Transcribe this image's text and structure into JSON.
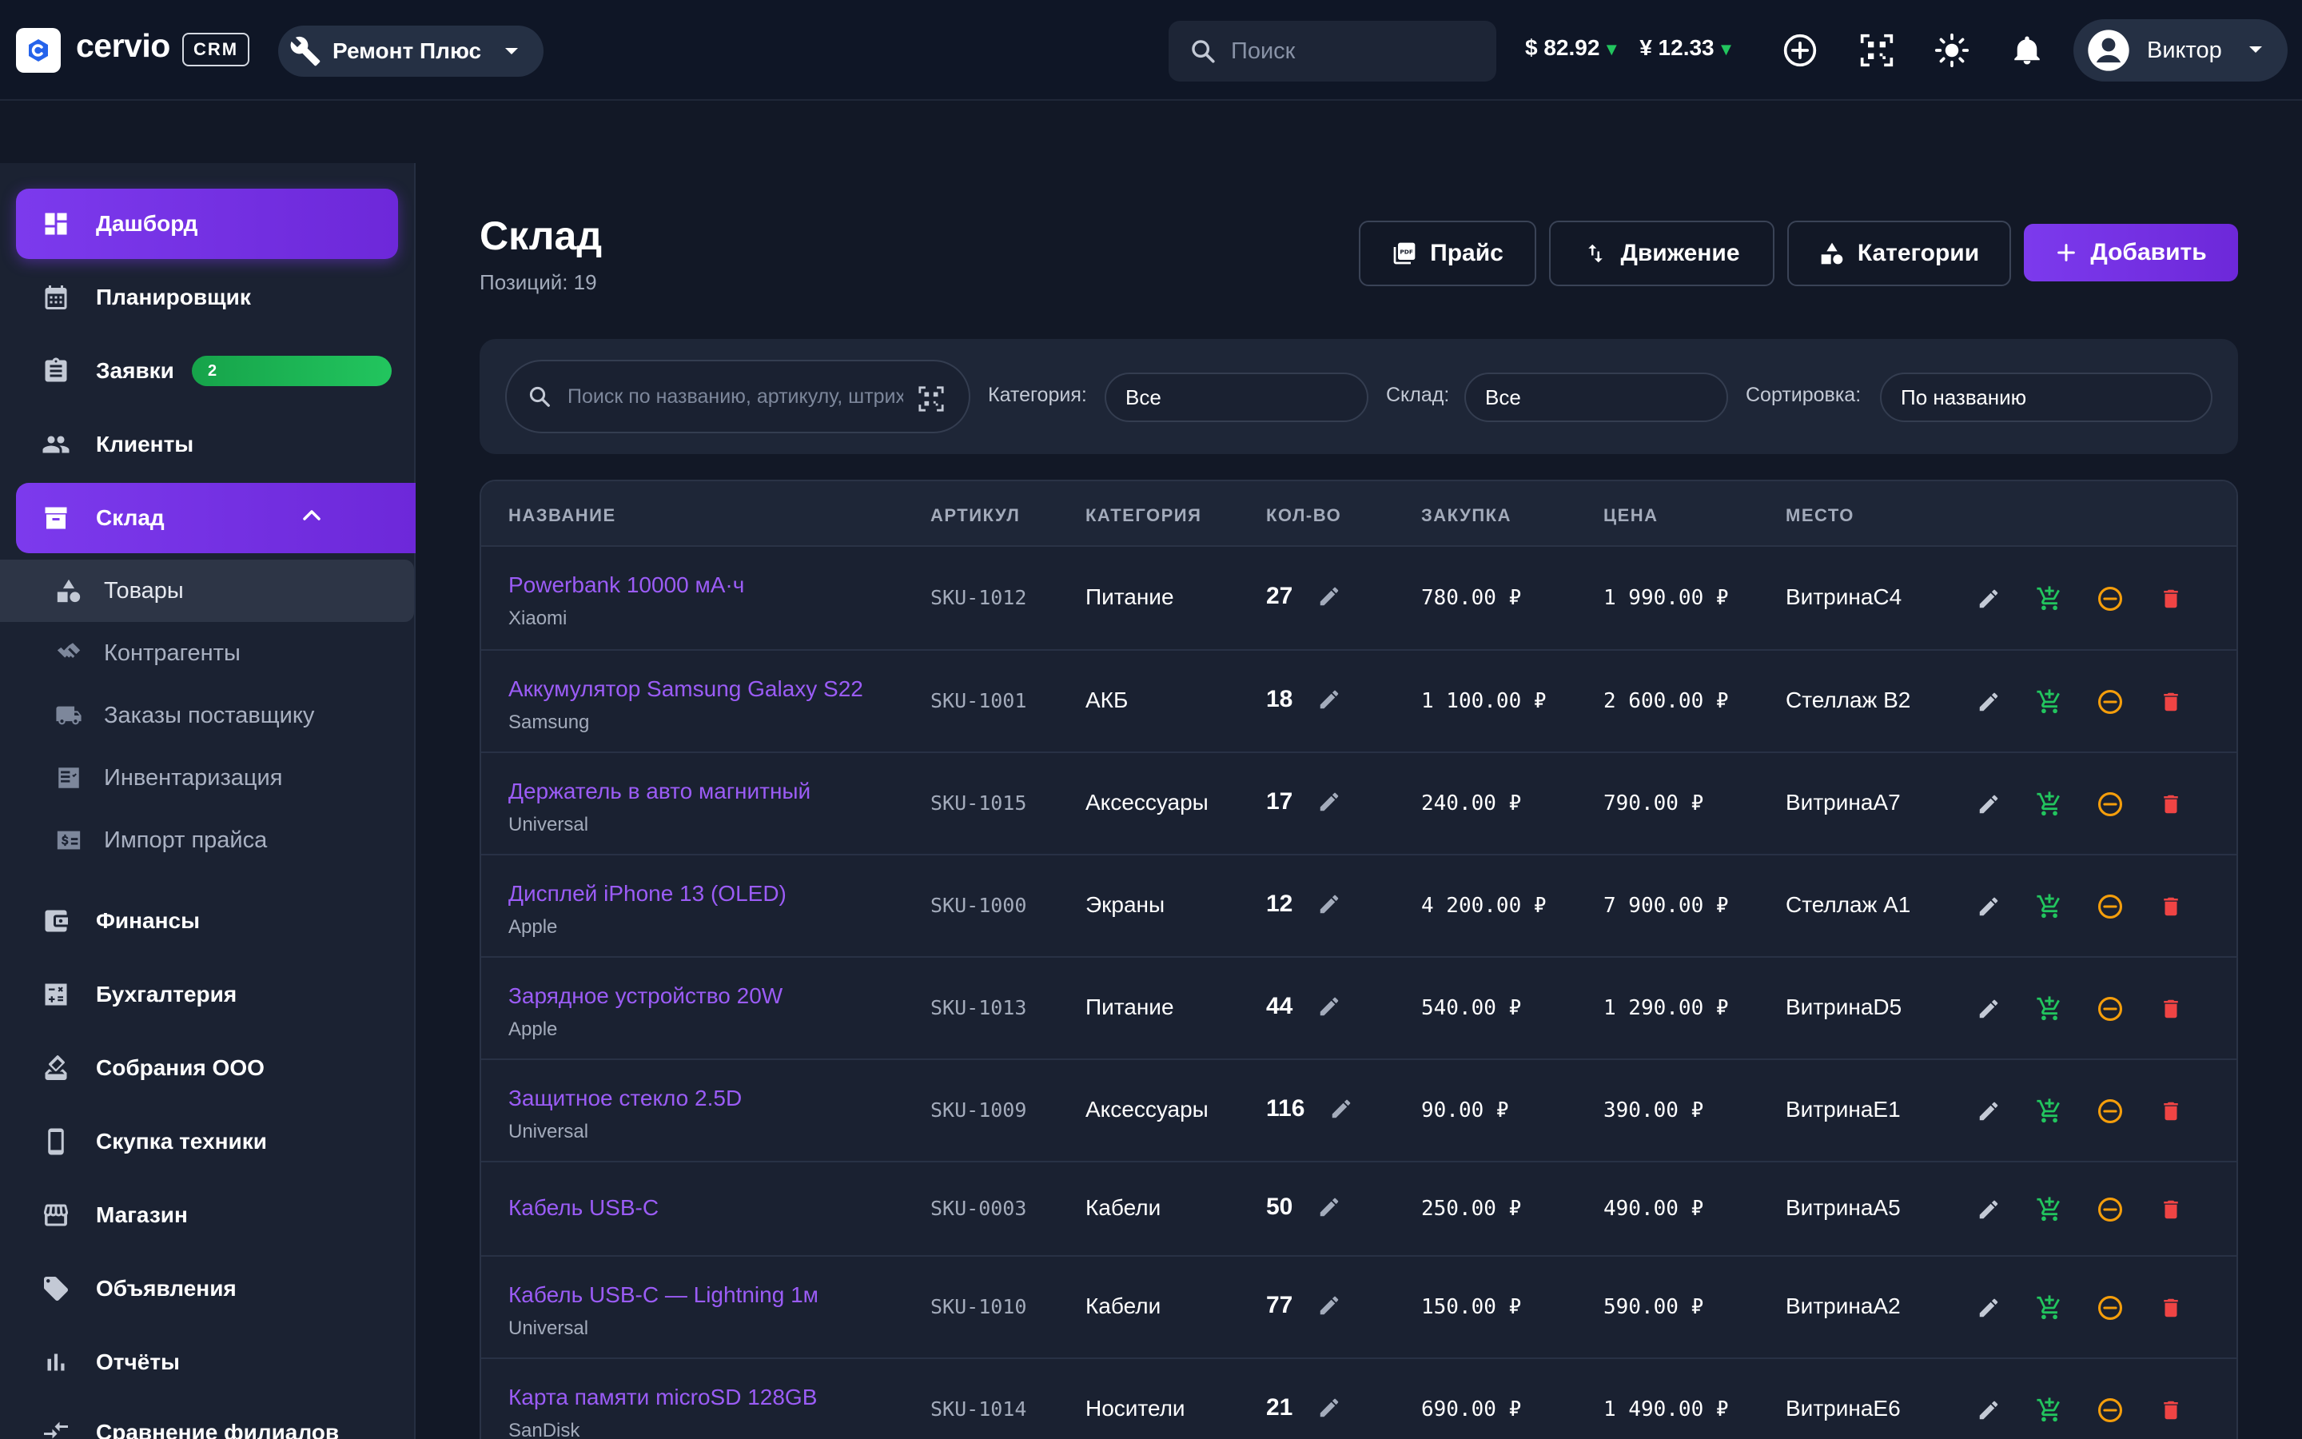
{
  "app": {
    "logo": "cervio",
    "badge": "CRM",
    "company": "Ремонт Плюс",
    "search_placeholder": "Поиск",
    "rate_usd": "$ 82.92",
    "rate_cny": "¥ 12.33",
    "user": "Виктор"
  },
  "sidebar": {
    "items": [
      {
        "label": "Дашборд",
        "icon": "dashboard-icon"
      },
      {
        "label": "Планировщик",
        "icon": "calendar-icon"
      },
      {
        "label": "Заявки",
        "icon": "clipboard-icon",
        "badge": "2"
      },
      {
        "label": "Клиенты",
        "icon": "people-icon"
      },
      {
        "label": "Склад",
        "icon": "archive-icon"
      }
    ],
    "sub_items": [
      {
        "label": "Товары",
        "icon": "shapes-icon"
      },
      {
        "label": "Контрагенты",
        "icon": "handshake-icon"
      },
      {
        "label": "Заказы поставщику",
        "icon": "truck-icon"
      },
      {
        "label": "Инвентаризация",
        "icon": "checklist-icon"
      },
      {
        "label": "Импорт прайса",
        "icon": "price-tag-icon"
      }
    ],
    "items2": [
      {
        "label": "Финансы",
        "icon": "wallet-icon"
      },
      {
        "label": "Бухгалтерия",
        "icon": "calculator-icon"
      },
      {
        "label": "Собрания ООО",
        "icon": "vote-icon"
      },
      {
        "label": "Скупка техники",
        "icon": "phone-icon"
      },
      {
        "label": "Магазин",
        "icon": "store-icon"
      },
      {
        "label": "Объявления",
        "icon": "tag-icon"
      },
      {
        "label": "Отчёты",
        "icon": "bar-chart-icon"
      },
      {
        "label": "Сравнение филиалов",
        "icon": "compare-icon"
      }
    ]
  },
  "page": {
    "title": "Склад",
    "subtitle": "Позиций: 19",
    "btn_price": "Прайс",
    "btn_movement": "Движение",
    "btn_categories": "Категории",
    "btn_add": "Добавить"
  },
  "filters": {
    "search_placeholder": "Поиск по названию, артикулу, штрихкоду",
    "category_label": "Категория:",
    "category_value": "Все",
    "warehouse_label": "Склад:",
    "warehouse_value": "Все",
    "sort_label": "Сортировка:",
    "sort_value": "По названию"
  },
  "table": {
    "columns": [
      "НАЗВАНИЕ",
      "АРТИКУЛ",
      "КАТЕГОРИЯ",
      "КОЛ-ВО",
      "ЗАКУПКА",
      "ЦЕНА",
      "МЕСТО"
    ],
    "rows": [
      {
        "name": "Powerbank 10000 мА·ч",
        "brand": "Xiaomi",
        "sku": "SKU-1012",
        "category": "Питание",
        "qty": "27",
        "buy": "780.00 ₽",
        "price": "1 990.00 ₽",
        "location": "ВитринаC4"
      },
      {
        "name": "Аккумулятор Samsung Galaxy S22",
        "brand": "Samsung",
        "sku": "SKU-1001",
        "category": "АКБ",
        "qty": "18",
        "buy": "1 100.00 ₽",
        "price": "2 600.00 ₽",
        "location": "Стеллаж B2"
      },
      {
        "name": "Держатель в авто магнитный",
        "brand": "Universal",
        "sku": "SKU-1015",
        "category": "Аксессуары",
        "qty": "17",
        "buy": "240.00 ₽",
        "price": "790.00 ₽",
        "location": "ВитринаA7"
      },
      {
        "name": "Дисплей iPhone 13 (OLED)",
        "brand": "Apple",
        "sku": "SKU-1000",
        "category": "Экраны",
        "qty": "12",
        "buy": "4 200.00 ₽",
        "price": "7 900.00 ₽",
        "location": "Стеллаж A1"
      },
      {
        "name": "Зарядное устройство 20W",
        "brand": "Apple",
        "sku": "SKU-1013",
        "category": "Питание",
        "qty": "44",
        "buy": "540.00 ₽",
        "price": "1 290.00 ₽",
        "location": "ВитринаD5"
      },
      {
        "name": "Защитное стекло 2.5D",
        "brand": "Universal",
        "sku": "SKU-1009",
        "category": "Аксессуары",
        "qty": "116",
        "buy": "90.00 ₽",
        "price": "390.00 ₽",
        "location": "ВитринаE1"
      },
      {
        "name": "Кабель USB-C",
        "brand": "",
        "sku": "SKU-0003",
        "category": "Кабели",
        "qty": "50",
        "buy": "250.00 ₽",
        "price": "490.00 ₽",
        "location": "ВитринаA5"
      },
      {
        "name": "Кабель USB-C — Lightning 1м",
        "brand": "Universal",
        "sku": "SKU-1010",
        "category": "Кабели",
        "qty": "77",
        "buy": "150.00 ₽",
        "price": "590.00 ₽",
        "location": "ВитринаA2"
      },
      {
        "name": "Карта памяти microSD 128GB",
        "brand": "SanDisk",
        "sku": "SKU-1014",
        "category": "Носители",
        "qty": "21",
        "buy": "690.00 ₽",
        "price": "1 490.00 ₽",
        "location": "ВитринаE6"
      }
    ]
  },
  "colors": {
    "accent": "#7c3aed",
    "link": "#9b5cf6",
    "success": "#22c55e",
    "warning": "#f59e0b",
    "danger": "#ef4444"
  }
}
